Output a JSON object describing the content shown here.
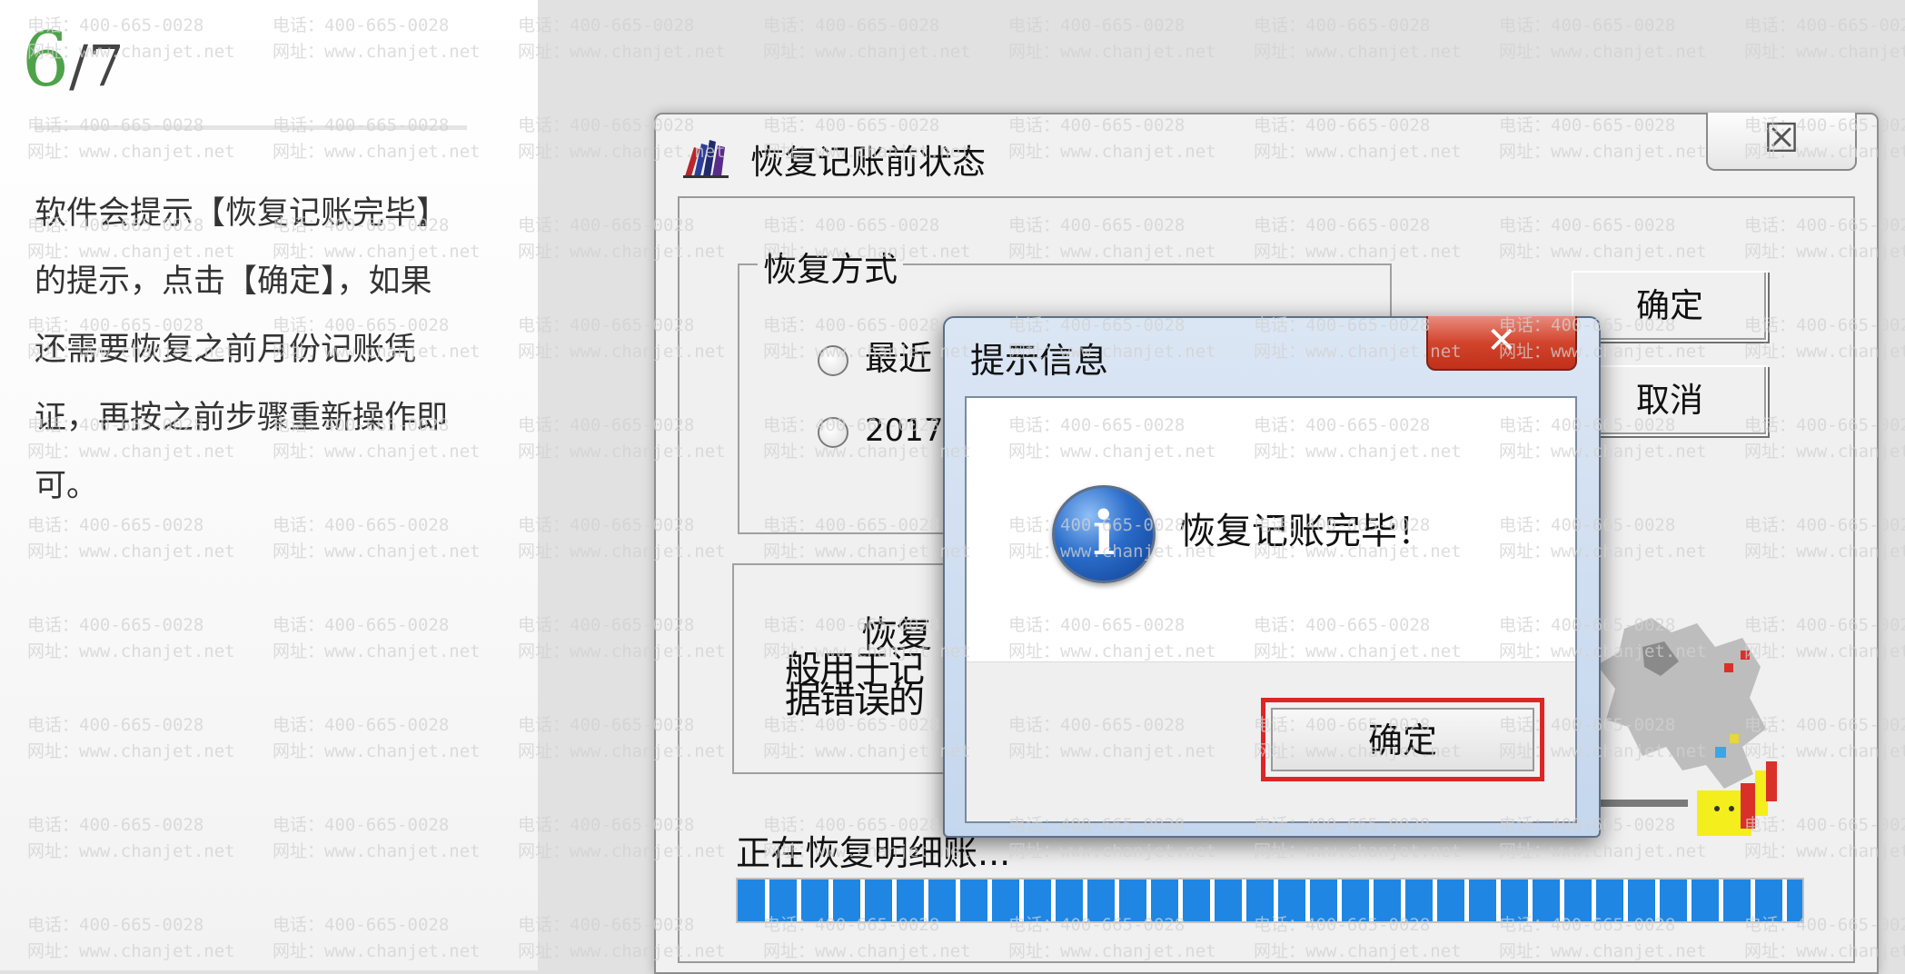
{
  "step": {
    "current": "6",
    "total": "/7"
  },
  "instruction": "软件会提示【恢复记账完毕】的提示，点击【确定】，如果还需要恢复之前月份记账凭证，再按之前步骤重新操作即可。",
  "watermark": {
    "phone": "电话：400-665-0028",
    "website": "网址：www.chanjet.net"
  },
  "main_dialog": {
    "title": "恢复记账前状态",
    "close_glyph": "☒",
    "restore_mode_label": "恢复方式",
    "radio_latest_label": "最近",
    "radio_2017_label": "2017",
    "ok_label": "确定",
    "cancel_label": "取消",
    "desc_lines": [
      "恢复",
      "般用于记",
      "据错误的"
    ],
    "progress_label": "正在恢复明细账...",
    "progress_fraction": 1.0,
    "icons": {
      "app": "ledger-books-icon",
      "animation": "restore-animation-icon"
    }
  },
  "message_box": {
    "title": "提示信息",
    "close_glyph": "✕",
    "message": "恢复记账完毕！",
    "icon": "info-icon",
    "ok_label": "确定"
  },
  "colors": {
    "accent_green": "#4ea24a",
    "progress_blue": "#1f86e3",
    "highlight_red": "#e02424",
    "close_red": "#c0301a"
  }
}
